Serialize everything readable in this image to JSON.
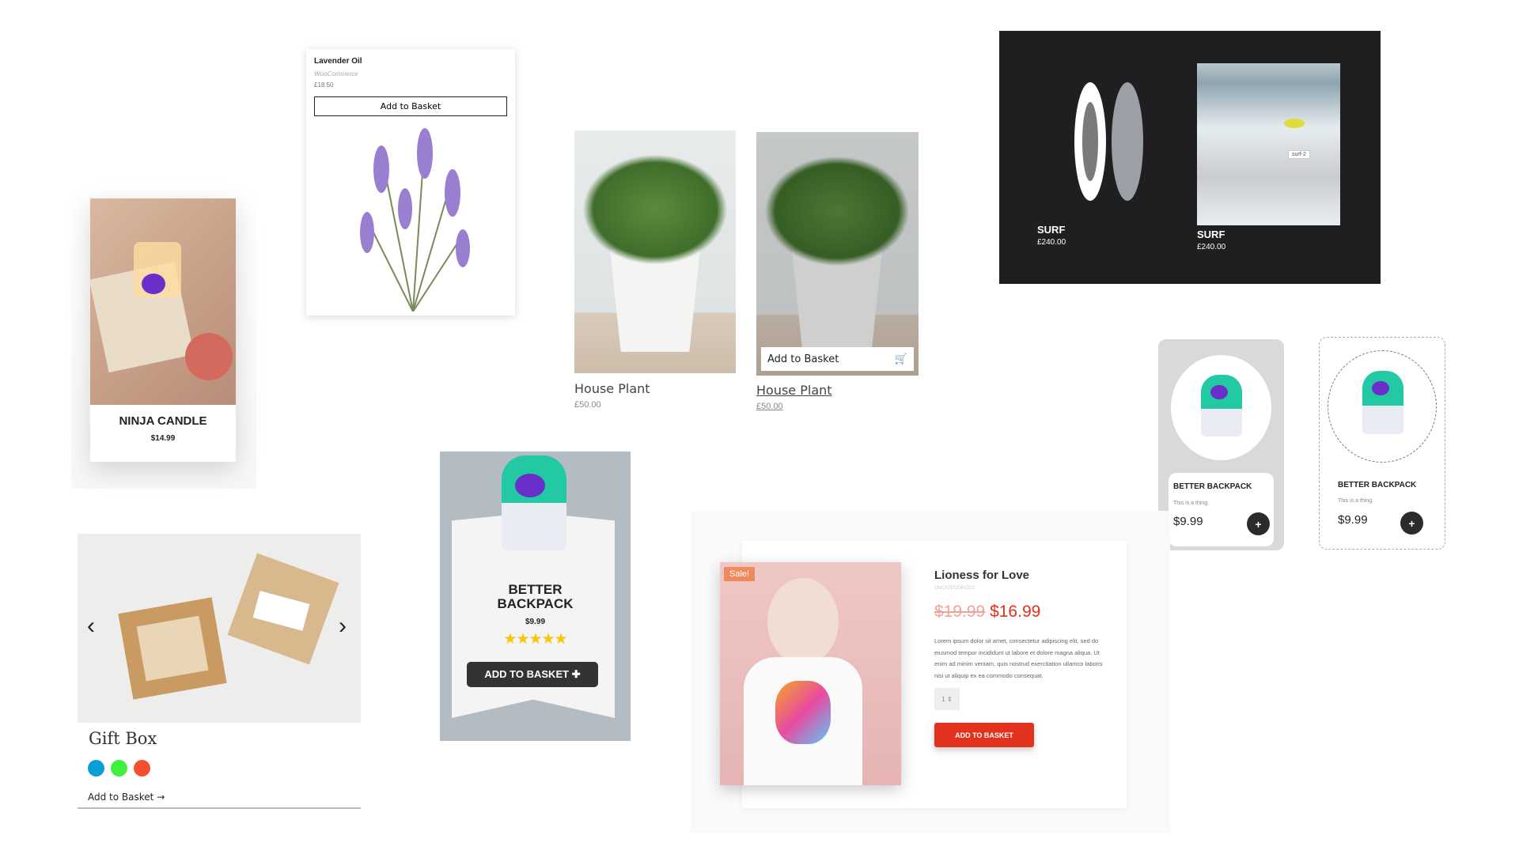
{
  "candle": {
    "title": "NINJA CANDLE",
    "price": "$14.99"
  },
  "lavender": {
    "title": "Lavender Oil",
    "brand": "WooCommerce",
    "price": "£18.50",
    "button": "Add to Basket"
  },
  "plant1": {
    "title": "House Plant",
    "price": "£50.00"
  },
  "plant2": {
    "title": "House Plant",
    "price": "£50.00",
    "button": "Add to Basket",
    "icon": "cart-icon"
  },
  "surf": {
    "items": [
      {
        "title": "SURF",
        "price": "£240.00"
      },
      {
        "title": "SURF",
        "price": "£240.00"
      }
    ],
    "tooltip": "surf-2"
  },
  "backpack_a": {
    "title": "BETTER BACKPACK",
    "desc": "This is a thing.",
    "price": "$9.99",
    "button": "+"
  },
  "backpack_b": {
    "title": "BETTER BACKPACK",
    "desc": "This is a thing.",
    "price": "$9.99",
    "button": "+"
  },
  "backpack_banner": {
    "title_line1": "BETTER",
    "title_line2": "BACKPACK",
    "price": "$9.99",
    "rating": 5,
    "rating_max": 5,
    "stars": "★★★★★",
    "button": "ADD TO BASKET"
  },
  "giftbox": {
    "title": "Gift Box",
    "swatches": [
      "#0a9ed6",
      "#3ef13a",
      "#f4502e"
    ],
    "link": "Add to Basket",
    "arrow": "→",
    "prev": "‹",
    "next": "›"
  },
  "lioness": {
    "badge": "Sale!",
    "title": "Lioness for Love",
    "category": "UNCATEGORIZED",
    "old_price": "$19.99",
    "price": "$16.99",
    "description": "Lorem ipsum dolor sit amet, consectetur adipiscing elit, sed do eiusmod tempor incididunt ut labore et dolore magna aliqua. Ut enim ad minim veniam, quis nostrud exercitation ullamco laboris nisi ut aliquip ex ea commodo consequat.",
    "quantity": "1",
    "button": "ADD TO BASKET",
    "accent": "#e2311d"
  }
}
